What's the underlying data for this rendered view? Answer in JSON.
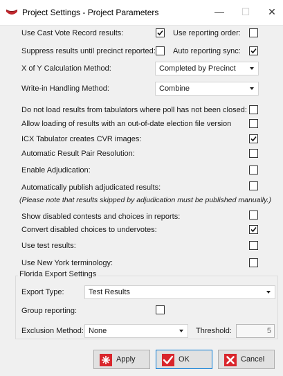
{
  "window": {
    "title": "Project Settings - Project Parameters",
    "minimize_glyph": "—",
    "maximize_glyph": "☐",
    "close_glyph": "✕"
  },
  "colors": {
    "brand": "#c0272d",
    "accent": "#0078d7"
  },
  "settings": {
    "use_cvr": {
      "label": "Use Cast Vote Record results:",
      "checked": true
    },
    "use_reporting_order": {
      "label": "Use reporting order:",
      "checked": false
    },
    "suppress_results": {
      "label": "Suppress results until precinct reported:",
      "checked": false
    },
    "auto_reporting_sync": {
      "label": "Auto reporting sync:",
      "checked": true
    },
    "xofy_method": {
      "label": "X of Y Calculation Method:",
      "value": "Completed by Precinct"
    },
    "writein_method": {
      "label": "Write-in Handling Method:",
      "value": "Combine"
    },
    "do_not_load": {
      "label": "Do not load results from tabulators where poll has not been closed:",
      "checked": false
    },
    "allow_out_of_date": {
      "label": "Allow loading of results with an out-of-date election file version",
      "checked": false
    },
    "icx_cvr_images": {
      "label": "ICX Tabulator creates CVR images:",
      "checked": true
    },
    "auto_result_pair": {
      "label": "Automatic Result Pair Resolution:",
      "checked": false
    },
    "enable_adjudication": {
      "label": "Enable Adjudication:",
      "checked": false
    },
    "auto_publish_adjudicated": {
      "label": "Automatically publish adjudicated results:",
      "checked": false
    },
    "adjudication_note": "(Please note that results skipped by adjudication must be published manually.)",
    "show_disabled": {
      "label": "Show disabled contests and choices in reports:",
      "checked": false
    },
    "convert_disabled": {
      "label": "Convert disabled choices to undervotes:",
      "checked": true
    },
    "use_test_results": {
      "label": "Use test results:",
      "checked": false
    },
    "use_ny_terminology": {
      "label": "Use New York terminology:",
      "checked": false
    }
  },
  "florida": {
    "group_title": "Florida Export Settings",
    "export_type": {
      "label": "Export Type:",
      "value": "Test Results"
    },
    "group_reporting": {
      "label": "Group reporting:",
      "checked": false
    },
    "exclusion_method": {
      "label": "Exclusion Method:",
      "value": "None"
    },
    "threshold": {
      "label": "Threshold:",
      "value": "5"
    }
  },
  "buttons": {
    "apply": {
      "label": "Apply",
      "icon": "apply-icon"
    },
    "ok": {
      "label": "OK",
      "icon": "checkmark-icon"
    },
    "cancel": {
      "label": "Cancel",
      "icon": "cancel-x-icon"
    }
  }
}
